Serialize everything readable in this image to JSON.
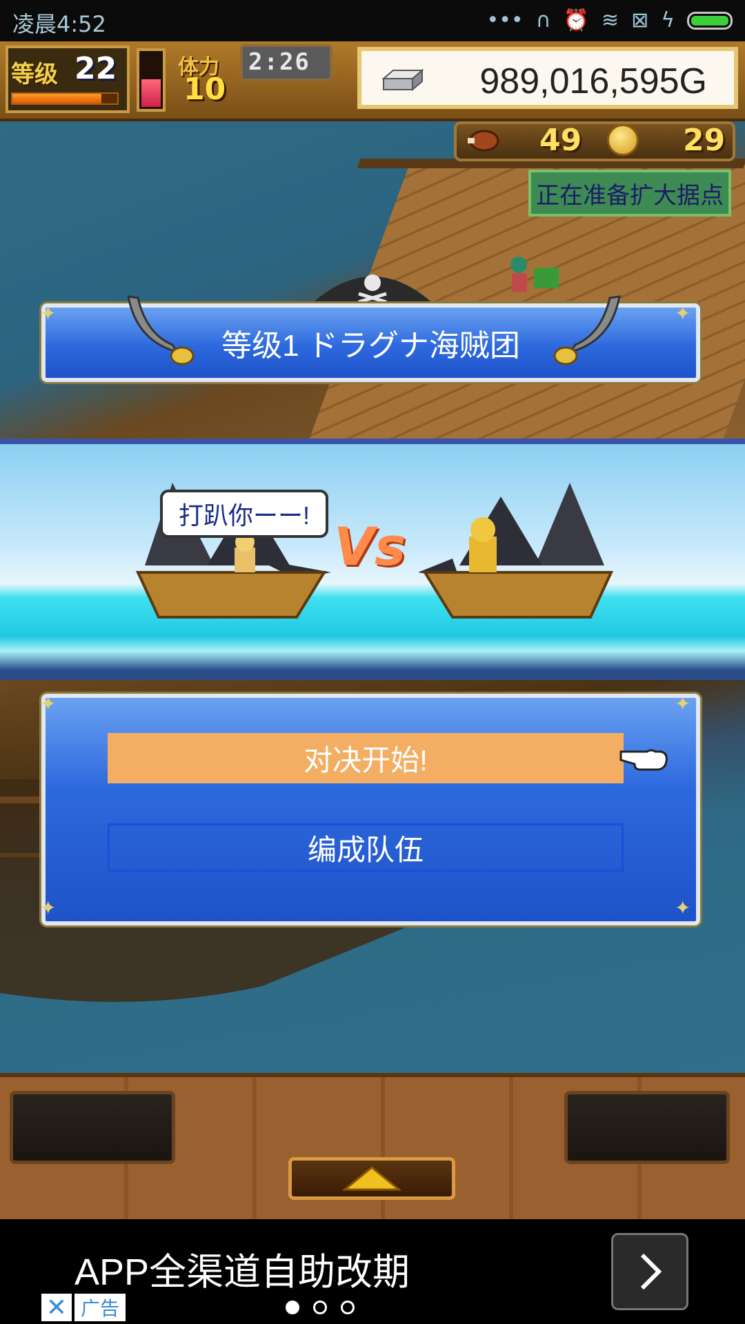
{
  "status_bar": {
    "time": "凌晨4:52",
    "icons": [
      "more-dots-icon",
      "headset-icon",
      "alarm-icon",
      "wifi-icon",
      "sim-off-icon",
      "charging-icon",
      "battery-icon"
    ]
  },
  "hud": {
    "level_label": "等级",
    "level_value": "22",
    "level_progress": 0.85,
    "stamina_label": "体力",
    "stamina_value": "10",
    "stamina_gauge_level": 0.55,
    "timer": "2:26",
    "gold": "989,016,595G"
  },
  "resources": {
    "food_value": "49",
    "coin_value": "29"
  },
  "expand_notice": "正在准备扩大据点",
  "title_banner": "等级1 ドラグナ海贼团",
  "battle": {
    "speech": "打趴你ーー!",
    "vs": "Vs"
  },
  "menu": {
    "start_label": "对决开始!",
    "formation_label": "编成队伍"
  },
  "ad": {
    "text": "APP全渠道自助改期",
    "close_label": "✕",
    "tag_label": "广告",
    "page_count": 3,
    "active_page": 0
  },
  "colors": {
    "banner_blue": "#2d69de",
    "start_button": "#f3ae63",
    "gold_panel": "#fdf8ef",
    "notice_green": "#3d8a52"
  }
}
